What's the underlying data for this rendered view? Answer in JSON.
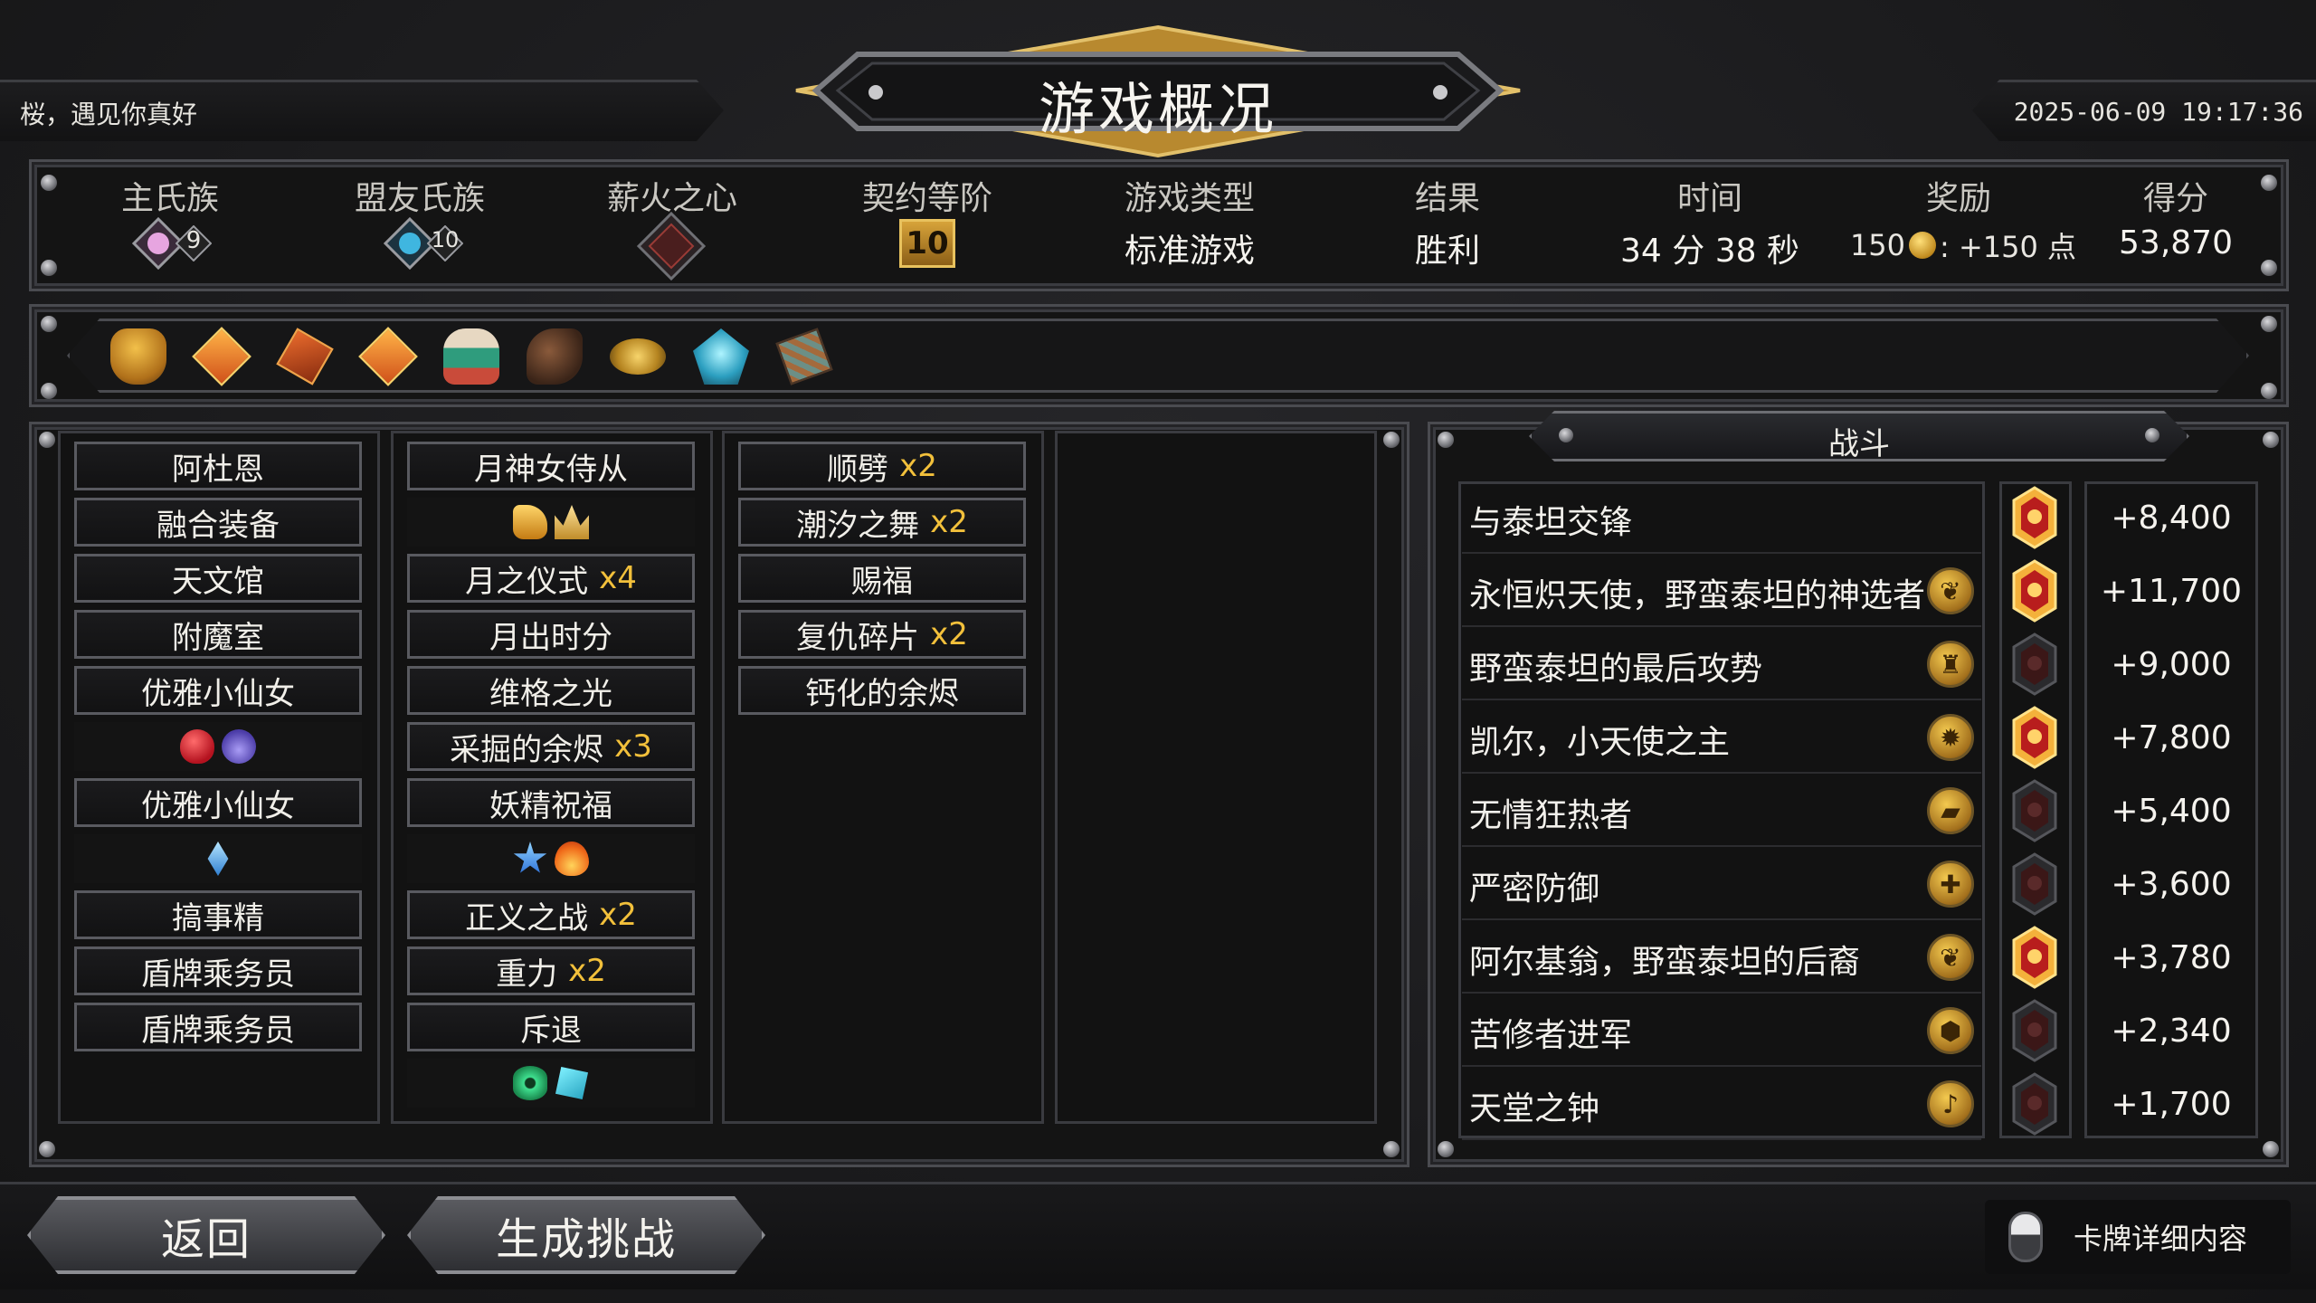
{
  "header": {
    "greeting": "桜，遇见你真好",
    "title": "游戏概况",
    "datetime": "2025-06-09 19:17:36"
  },
  "stats": {
    "main_clan_label": "主氏族",
    "main_clan_level": "9",
    "ally_clan_label": "盟友氏族",
    "ally_clan_level": "10",
    "pyre_label": "薪火之心",
    "covenant_label": "契约等阶",
    "covenant_value": "10",
    "mode_label": "游戏类型",
    "mode_value": "标准游戏",
    "result_label": "结果",
    "result_value": "胜利",
    "time_label": "时间",
    "time_value": "34 分 38 秒",
    "reward_label": "奖励",
    "reward_amount": "150",
    "reward_points": ": +150 点",
    "score_label": "得分",
    "score_value": "53,870"
  },
  "artifacts": [
    "artifact-1",
    "artifact-2",
    "artifact-3",
    "artifact-4",
    "artifact-5",
    "artifact-6",
    "artifact-7",
    "artifact-8",
    "artifact-9"
  ],
  "deck": {
    "col1": [
      {
        "name": "阿杜恩"
      },
      {
        "name": "融合装备"
      },
      {
        "name": "天文馆"
      },
      {
        "name": "附魔室"
      },
      {
        "name": "优雅小仙女"
      },
      {
        "icons": [
          "heart-icon",
          "horns-icon"
        ]
      },
      {
        "name": "优雅小仙女"
      },
      {
        "icons": [
          "crystal-icon"
        ]
      },
      {
        "name": "搞事精"
      },
      {
        "name": "盾牌乘务员"
      },
      {
        "name": "盾牌乘务员"
      }
    ],
    "col2": [
      {
        "name": "月神女侍从"
      },
      {
        "icons": [
          "boot-icon",
          "crown-icon"
        ]
      },
      {
        "name": "月之仪式",
        "mult": "x4"
      },
      {
        "name": "月出时分"
      },
      {
        "name": "维格之光"
      },
      {
        "name": "采掘的余烬",
        "mult": "x3"
      },
      {
        "name": "妖精祝福"
      },
      {
        "icons": [
          "star-icon",
          "flame-icon"
        ]
      },
      {
        "name": "正义之战",
        "mult": "x2"
      },
      {
        "name": "重力",
        "mult": "x2"
      },
      {
        "name": "斥退"
      },
      {
        "icons": [
          "eye-icon",
          "card-icon"
        ]
      }
    ],
    "col3": [
      {
        "name": "顺劈",
        "mult": "x2"
      },
      {
        "name": "潮汐之舞",
        "mult": "x2"
      },
      {
        "name": "赐福"
      },
      {
        "name": "复仇碎片",
        "mult": "x2"
      },
      {
        "name": "钙化的余烬"
      }
    ]
  },
  "battle": {
    "title": "战斗",
    "rows": [
      {
        "name": "与泰坦交锋",
        "boss": "boss-red",
        "score": "+8,400",
        "icon": ""
      },
      {
        "name": "永恒炽天使，野蛮泰坦的神选者",
        "boss": "boss-red",
        "score": "+11,700",
        "icon": "wing-icon"
      },
      {
        "name": "野蛮泰坦的最后攻势",
        "boss": "boss-dark",
        "score": "+9,000",
        "icon": "figure-icon"
      },
      {
        "name": "凯尔，小天使之主",
        "boss": "boss-red",
        "score": "+7,800",
        "icon": "burst-icon"
      },
      {
        "name": "无情狂热者",
        "boss": "boss-dark",
        "score": "+5,400",
        "icon": "bar-icon"
      },
      {
        "name": "严密防御",
        "boss": "boss-dark",
        "score": "+3,600",
        "icon": "plus-icon"
      },
      {
        "name": "阿尔基翁，野蛮泰坦的后裔",
        "boss": "boss-red",
        "score": "+3,780",
        "icon": "wing-icon"
      },
      {
        "name": "苦修者进军",
        "boss": "boss-dark",
        "score": "+2,340",
        "icon": "honeycomb-icon"
      },
      {
        "name": "天堂之钟",
        "boss": "boss-dark",
        "score": "+1,700",
        "icon": "bell-icon"
      }
    ]
  },
  "footer": {
    "back_label": "返回",
    "challenge_label": "生成挑战",
    "card_details_label": "卡牌详细内容"
  }
}
